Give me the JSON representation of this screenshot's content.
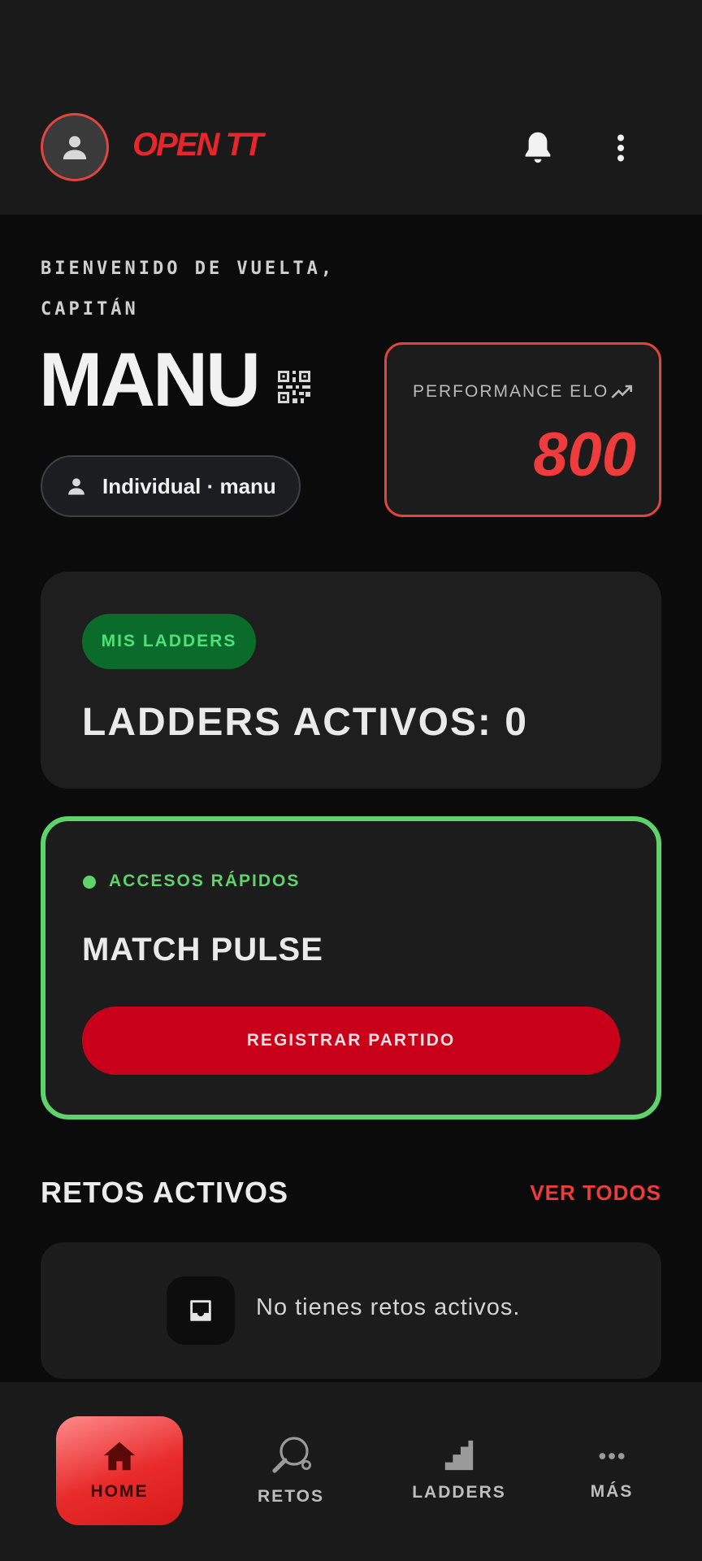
{
  "header": {
    "brand": "OPEN TT",
    "avatar_icon": "person-icon",
    "notifications_icon": "bell-icon",
    "menu_icon": "kebab-menu-icon"
  },
  "profile": {
    "welcome_line1": "BIENVENIDO DE VUELTA,",
    "welcome_line2": "CAPITÁN",
    "name": "MANU",
    "qr_icon": "qr-code-icon",
    "account_label": "Individual · manu"
  },
  "elo": {
    "label": "PERFORMANCE ELO",
    "value": "800",
    "trend_icon": "trending-up-icon"
  },
  "ladders": {
    "badge": "MIS LADDERS",
    "count_text": "LADDERS ACTIVOS: 0"
  },
  "quick_access": {
    "label": "ACCESOS RÁPIDOS",
    "title": "MATCH PULSE",
    "button": "REGISTRAR PARTIDO"
  },
  "challenges": {
    "title": "RETOS ACTIVOS",
    "see_all": "VER TODOS",
    "empty_text": "No tienes retos activos.",
    "empty_icon": "inbox-icon"
  },
  "bottom_nav": {
    "items": [
      {
        "label": "HOME",
        "icon": "home-icon",
        "active": true
      },
      {
        "label": "RETOS",
        "icon": "ping-pong-paddle-icon",
        "active": false
      },
      {
        "label": "LADDERS",
        "icon": "stairs-icon",
        "active": false
      },
      {
        "label": "MÁS",
        "icon": "more-dots-icon",
        "active": false
      }
    ]
  },
  "colors": {
    "accent_red": "#e0453f",
    "button_red": "#c8001a",
    "accent_green": "#5fd36b",
    "badge_green": "#0b6b2a",
    "background": "#0b0b0b",
    "card": "#1e1e1e"
  }
}
